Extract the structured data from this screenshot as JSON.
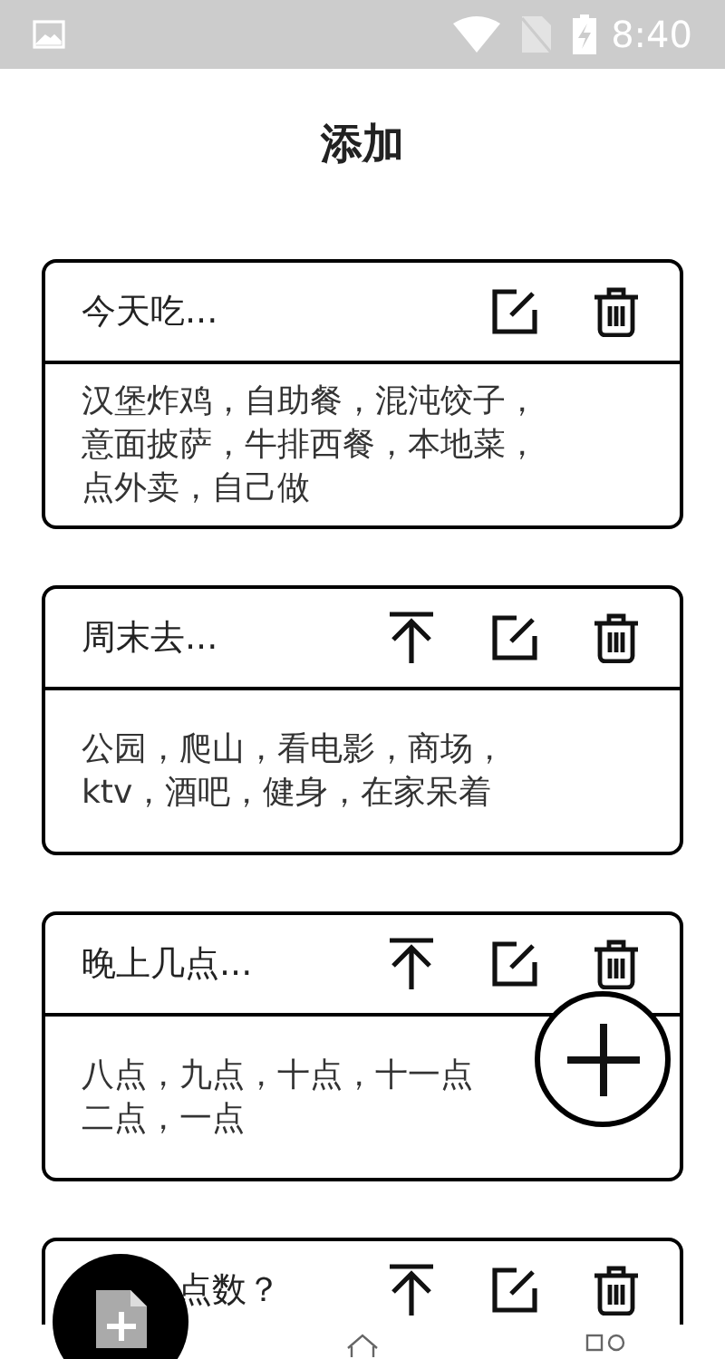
{
  "status_bar": {
    "time": "8:40"
  },
  "title": "添加",
  "cards": [
    {
      "title": "今天吃...",
      "top_button": false,
      "lines": [
        "汉堡炸鸡，自助餐，混沌饺子，",
        "意面披萨，牛排西餐，本地菜，",
        "点外卖，自己做"
      ]
    },
    {
      "title": "周末去...",
      "top_button": true,
      "lines": [
        "公园，爬山，看电影，商场，",
        "ktv，酒吧，健身，在家呆着"
      ]
    },
    {
      "title": "晚上几点...",
      "top_button": true,
      "lines": [
        "八点，九点，十点，十一点",
        "二点，一点"
      ]
    },
    {
      "title": "点数？",
      "top_button": true
    }
  ]
}
